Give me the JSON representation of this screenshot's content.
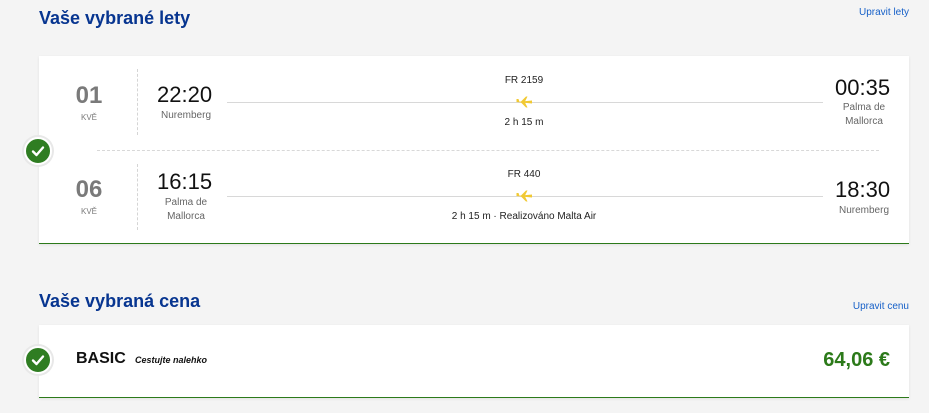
{
  "flights_section": {
    "title": "Vaše vybrané lety",
    "edit_label": "Upravit lety",
    "flights": [
      {
        "day": "01",
        "month": "KVĚ",
        "depart_time": "22:20",
        "depart_city": "Nuremberg",
        "flight_number": "FR 2159",
        "duration": "2 h 15 m",
        "arrive_time": "00:35",
        "arrive_city": "Palma de Mallorca"
      },
      {
        "day": "06",
        "month": "KVĚ",
        "depart_time": "16:15",
        "depart_city": "Palma de Mallorca",
        "flight_number": "FR 440",
        "duration": "2 h 15 m · Realizováno Malta Air",
        "arrive_time": "18:30",
        "arrive_city": "Nuremberg"
      }
    ]
  },
  "fare_section": {
    "title": "Vaše vybraná cena",
    "edit_label": "Upravit cenu",
    "fare_name": "BASIC",
    "fare_tagline": "Cestujte nalehko",
    "price": "64,06 €"
  },
  "colors": {
    "title_blue": "#073590",
    "link_blue": "#1660c8",
    "check_green": "#2f7d22",
    "price_green": "#2c7a1a",
    "plane_yellow": "#f1c933"
  },
  "icons": {
    "check": "check-icon",
    "plane": "plane-icon"
  }
}
